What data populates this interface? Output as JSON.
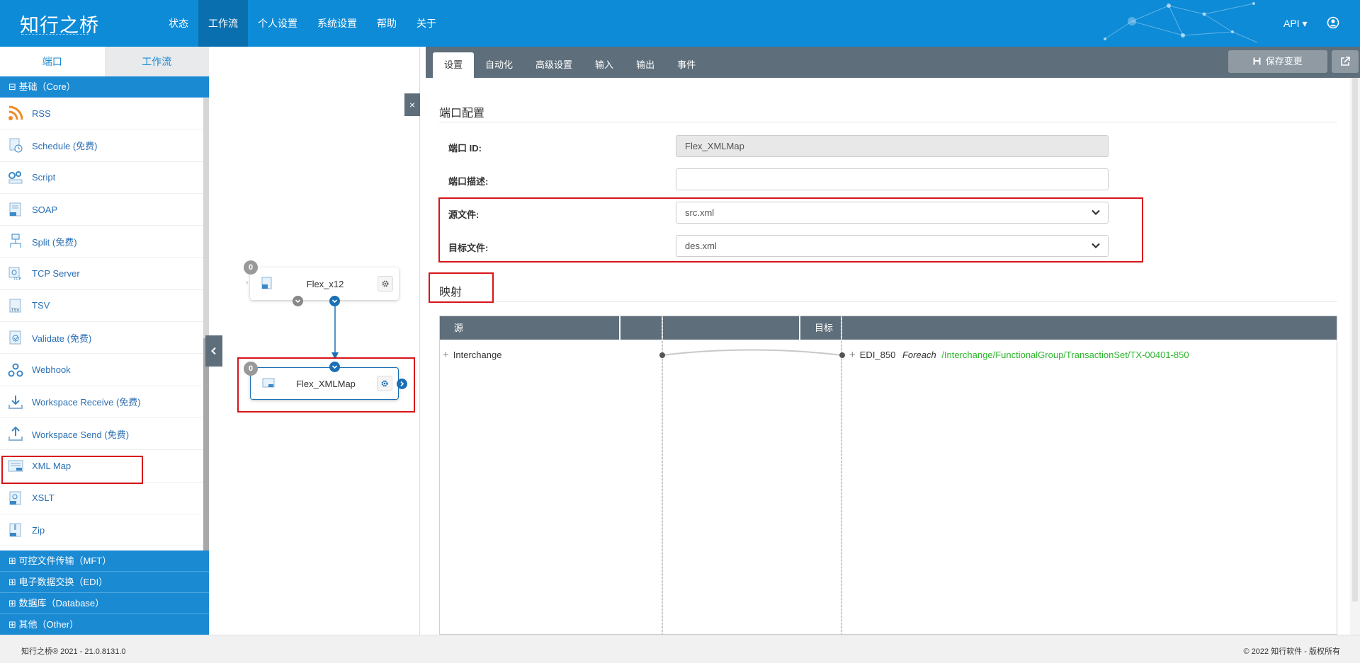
{
  "header": {
    "logo": "知行之桥",
    "nav": [
      "状态",
      "工作流",
      "个人设置",
      "系统设置",
      "帮助",
      "关于"
    ],
    "active_nav": "工作流",
    "api_label": "API ▾",
    "brand_color": "#0d8bd7"
  },
  "sidebar": {
    "tabs": [
      "端口",
      "工作流"
    ],
    "active_tab": "端口",
    "core_group": "⊟ 基础（Core）",
    "items": [
      {
        "label": "RSS",
        "icon": "rss-icon"
      },
      {
        "label": "Schedule (免费)",
        "icon": "schedule-icon"
      },
      {
        "label": "Script",
        "icon": "script-icon"
      },
      {
        "label": "SOAP",
        "icon": "soap-icon"
      },
      {
        "label": "Split (免费)",
        "icon": "split-icon"
      },
      {
        "label": "TCP Server",
        "icon": "tcp-icon"
      },
      {
        "label": "TSV",
        "icon": "tsv-icon"
      },
      {
        "label": "Validate (免费)",
        "icon": "validate-icon"
      },
      {
        "label": "Webhook",
        "icon": "webhook-icon"
      },
      {
        "label": "Workspace Receive (免费)",
        "icon": "download-icon"
      },
      {
        "label": "Workspace Send (免费)",
        "icon": "upload-icon"
      },
      {
        "label": "XML Map",
        "icon": "xml-map-icon"
      },
      {
        "label": "XSLT",
        "icon": "xslt-icon"
      },
      {
        "label": "Zip",
        "icon": "zip-icon"
      }
    ],
    "groups": [
      "⊞ 可控文件传输（MFT）",
      "⊞ 电子数据交换（EDI）",
      "⊞ 数据库（Database）",
      "⊞ 其他（Other）"
    ]
  },
  "canvas": {
    "node1": {
      "label": "Flex_x12",
      "badge": "0"
    },
    "node2": {
      "label": "Flex_XMLMap",
      "badge": "0"
    },
    "close": "×"
  },
  "main": {
    "tabs": [
      "设置",
      "自动化",
      "高级设置",
      "输入",
      "输出",
      "事件"
    ],
    "active_tab": "设置",
    "save_label": "保存变更",
    "section_config": "端口配置",
    "fields": {
      "id_label": "端口 ID:",
      "id_value": "Flex_XMLMap",
      "desc_label": "端口描述:",
      "desc_value": "",
      "src_label": "源文件:",
      "src_value": "src.xml",
      "dst_label": "目标文件:",
      "dst_value": "des.xml"
    },
    "section_map": "映射",
    "map": {
      "src_header": "源",
      "dst_header": "目标",
      "src_node": "Interchange",
      "dst_node": "EDI_850",
      "foreach": "Foreach",
      "path": "/Interchange/FunctionalGroup/TransactionSet/TX-00401-850",
      "path_color": "#2db52d"
    }
  },
  "footer": {
    "left": "知行之桥® 2021 - 21.0.8131.0",
    "right": "© 2022 知行软件 - 版权所有"
  }
}
